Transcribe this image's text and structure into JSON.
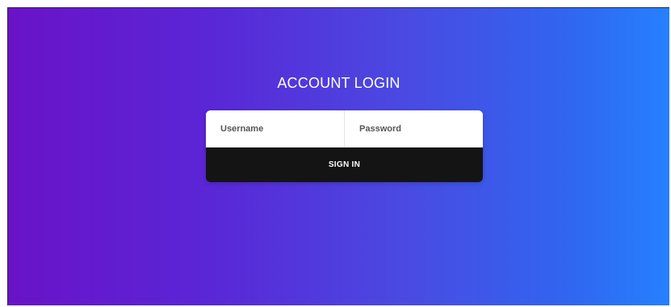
{
  "login": {
    "title": "ACCOUNT LOGIN",
    "username_placeholder": "Username",
    "password_placeholder": "Password",
    "signin_label": "SIGN IN"
  },
  "colors": {
    "gradient_start": "#6a12c8",
    "gradient_end": "#2680ff",
    "button_bg": "#141414",
    "card_bg": "#ffffff"
  }
}
